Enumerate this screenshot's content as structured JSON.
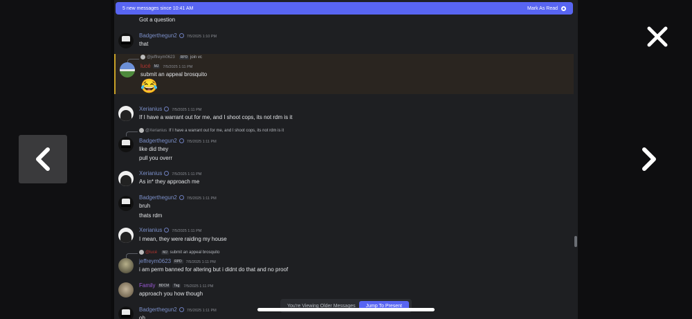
{
  "banner": {
    "text": "5 new messages since 10:41 AM",
    "mark_read": "Mark As Read"
  },
  "messages": [
    {
      "text": "Got a question"
    },
    {
      "author": "Badgerthegun2",
      "time": "7/5/2025 1:10 PM",
      "text": "that"
    },
    {
      "reply": {
        "author": "@jeffreym0623",
        "tag": "RPD",
        "text": "join vc"
      },
      "author": "lucé",
      "tag": "MJ",
      "time": "7/5/2025 1:11 PM",
      "text": "submit an appeal brosquito",
      "emoji": "😂"
    },
    {
      "author": "Xerianius",
      "time": "7/5/2025 1:11 PM",
      "text": "If I have a warrant out for me, and I shoot cops, its not rdm is it"
    },
    {
      "reply": {
        "author": "@Xerianius",
        "text": "If I have a warrant out for me, and I shoot cops, its not rdm is it"
      },
      "author": "Badgerthegun2",
      "time": "7/5/2025 1:11 PM",
      "text": "like did they",
      "text2": "pull you overr"
    },
    {
      "author": "Xerianius",
      "time": "7/5/2025 1:11 PM",
      "text": "As in* they approach me"
    },
    {
      "author": "Badgerthegun2",
      "time": "7/5/2025 1:11 PM",
      "text": "bruh",
      "text2": "thats rdm"
    },
    {
      "author": "Xerianius",
      "time": "7/5/2025 1:11 PM",
      "text": "I mean, they were raiding my house"
    },
    {
      "reply": {
        "author": "@lucé",
        "tag": "MJ",
        "text": "submit an appeal brosquito"
      },
      "author": "jeffreym0623",
      "tag": "RPD",
      "time": "7/5/2025 1:11 PM",
      "text": "i am perm banned for altering but i didnt do that and no proof"
    },
    {
      "author": "Family",
      "tag": "BDCM",
      "tag2": "Tag",
      "time": "7/5/2025 1:11 PM",
      "text": "approach you how though"
    },
    {
      "author": "Badgerthegun2",
      "time": "7/5/2025 1:11 PM",
      "text": "oh"
    }
  ],
  "footer": {
    "older": "You're Viewing Older Messages",
    "jump": "Jump To Present"
  },
  "icons": {
    "close": "close-icon",
    "prev": "chevron-left-icon",
    "next": "chevron-right-icon"
  },
  "colors": {
    "accent": "#5865f2",
    "highlight": "#c9a227",
    "name_blue": "#7b8fc9",
    "name_red": "#b5352f",
    "name_purple": "#9b59d6"
  }
}
